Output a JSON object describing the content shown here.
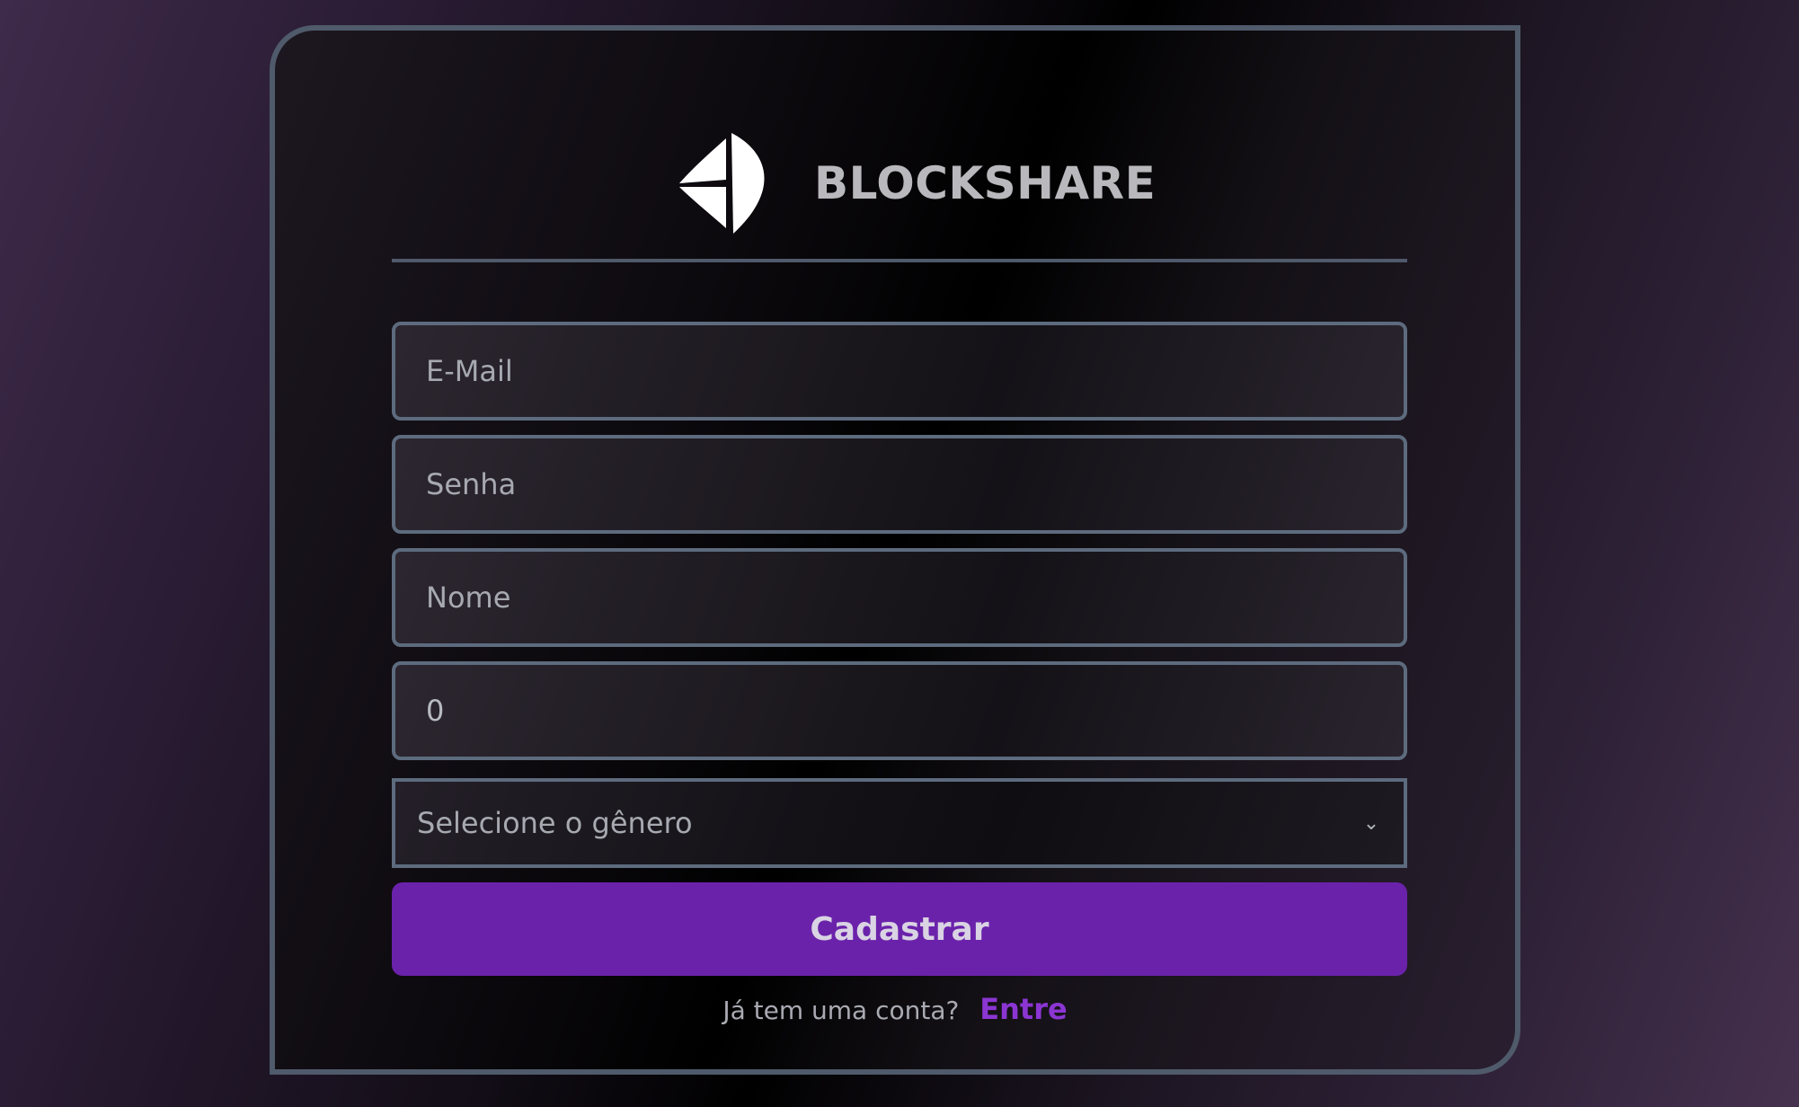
{
  "brand": {
    "name": "BLOCKSHARE",
    "logo_icon": "sail-icon"
  },
  "form": {
    "email_placeholder": "E-Mail",
    "password_placeholder": "Senha",
    "name_placeholder": "Nome",
    "number_value": "0",
    "gender_select_value": "Selecione o gênero",
    "submit_label": "Cadastrar"
  },
  "footer": {
    "prompt": "Já tem uma conta?",
    "login_link": "Entre"
  },
  "colors": {
    "accent": "#6b22ab",
    "link": "#8b35d3",
    "border": "#5d6b7e"
  }
}
